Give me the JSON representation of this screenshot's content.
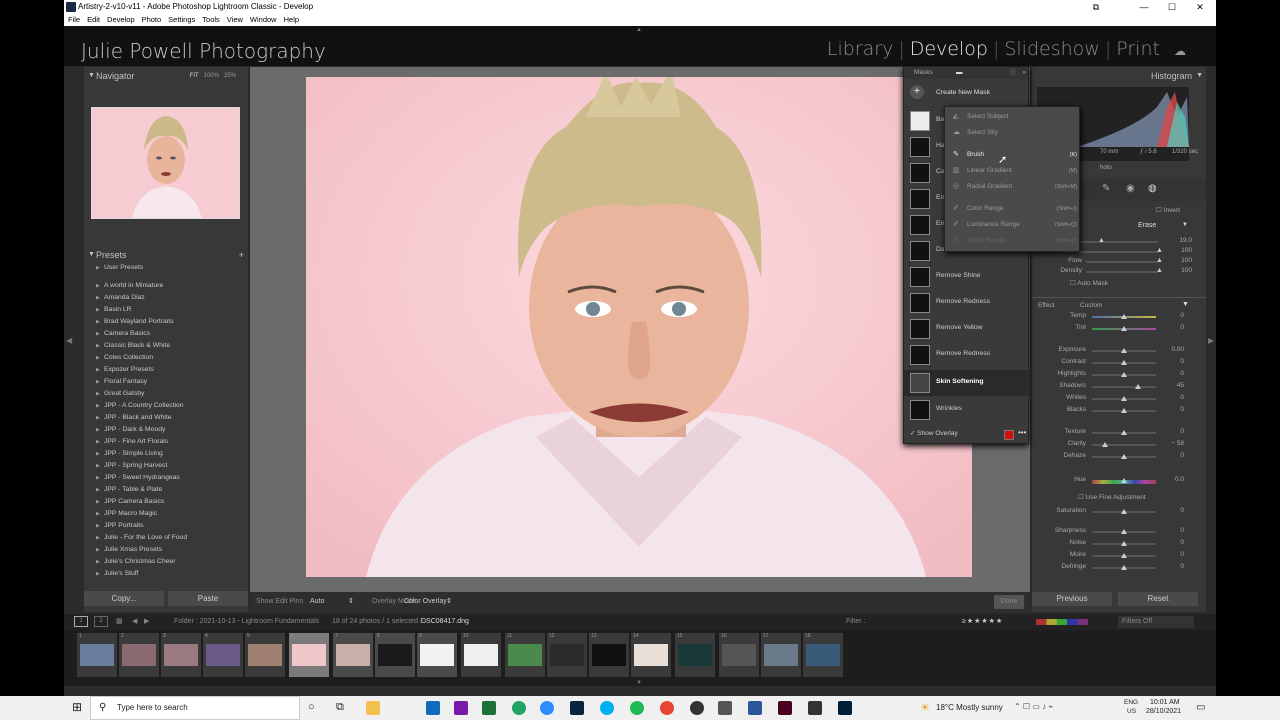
{
  "window": {
    "title": "Artistry-2-v10-v11 - Adobe Photoshop Lightroom Classic - Develop"
  },
  "menu": [
    "File",
    "Edit",
    "Develop",
    "Photo",
    "Settings",
    "Tools",
    "View",
    "Window",
    "Help"
  ],
  "identity": {
    "brand": "Julie Powell Photography"
  },
  "modules": [
    "Library",
    "Develop",
    "Slideshow",
    "Print"
  ],
  "navigator": {
    "title": "Navigator",
    "zoom_fit": "FIT",
    "zoom_100": "100%",
    "zoom_25": "25%"
  },
  "presets": {
    "title": "Presets",
    "items": [
      "User Presets",
      "A world in Miniature",
      "Amanda Diaz",
      "Basin LR",
      "Brad Wayland Portraits",
      "Camera Basics",
      "Classic Black & White",
      "Coles Collection",
      "Expozer Presets",
      "Floral Fantasy",
      "Great Gatsby",
      "JPP - A Country Collection",
      "JPP - Black and White",
      "JPP - Dark & Moody",
      "JPP - Fine Art Florals",
      "JPP - Simple Living",
      "JPP - Spring Harvest",
      "JPP - Sweet Hydrangeas",
      "JPP - Table & Plate",
      "JPP Camera Basics",
      "JPP Macro Magic",
      "JPP Portraits",
      "Julie - For the Love of Food",
      "Julie Xmas Presets",
      "Julie's Christmas Cheer",
      "Julie's Stuff"
    ]
  },
  "left_buttons": {
    "copy": "Copy...",
    "paste": "Paste"
  },
  "toolbar": {
    "show_edit_pins": "Show Edit Pins",
    "pins_value": "Auto",
    "overlay_mode": "Overlay Mode",
    "overlay_value": "Color Overlay",
    "done": "Done"
  },
  "masks": {
    "title": "Masks",
    "create": "Create New Mask",
    "items": [
      "Background",
      "Hair",
      "Catchlight",
      "Enhance Eyes",
      "Enhance Eyes",
      "Darken Eyes",
      "Remove Shine",
      "Remove Redness",
      "Remove Yellow",
      "Remove Redness",
      "Skin Softening",
      "Wrinkles"
    ],
    "selected": "Skin Softening",
    "show_overlay": "Show Overlay",
    "overlay_color": "#d01010"
  },
  "dropdown": {
    "items": [
      {
        "label": "Select Subject",
        "shortcut": ""
      },
      {
        "label": "Select Sky",
        "shortcut": ""
      },
      {
        "label": "Brush",
        "shortcut": "(K)"
      },
      {
        "label": "Linear Gradient",
        "shortcut": "(M)"
      },
      {
        "label": "Radial Gradient",
        "shortcut": "(Shift+M)"
      },
      {
        "label": "Color Range",
        "shortcut": "(Shift+J)"
      },
      {
        "label": "Luminance Range",
        "shortcut": "(Shift+Q)"
      },
      {
        "label": "Depth Range",
        "shortcut": "(Shift+Z)"
      }
    ]
  },
  "histogram": {
    "title": "Histogram",
    "focal": "70 mm",
    "aperture": "ƒ / 5.6",
    "shutter": "1/320 sec",
    "label_photo": "hoto"
  },
  "brush": {
    "invert": "Invert",
    "erase": "Erase",
    "size": "19.0",
    "feather": "100",
    "flow_label": "Flow",
    "flow": "100",
    "density_label": "Density",
    "density": "100",
    "auto_mask": "Auto Mask"
  },
  "effect": {
    "label": "Effect",
    "preset": "Custom",
    "sliders": [
      {
        "name": "Temp",
        "value": "0",
        "pos": 0.5
      },
      {
        "name": "Tint",
        "value": "0",
        "pos": 0.5
      },
      {
        "name": "Exposure",
        "value": "0.00",
        "pos": 0.5
      },
      {
        "name": "Contrast",
        "value": "0",
        "pos": 0.5
      },
      {
        "name": "Highlights",
        "value": "0",
        "pos": 0.5
      },
      {
        "name": "Shadows",
        "value": "45",
        "pos": 0.72
      },
      {
        "name": "Whites",
        "value": "0",
        "pos": 0.5
      },
      {
        "name": "Blacks",
        "value": "0",
        "pos": 0.5
      },
      {
        "name": "Texture",
        "value": "0",
        "pos": 0.5
      },
      {
        "name": "Clarity",
        "value": "− 58",
        "pos": 0.21
      },
      {
        "name": "Dehaze",
        "value": "0",
        "pos": 0.5
      },
      {
        "name": "Hue",
        "value": "0.0",
        "pos": 0.5
      },
      {
        "name": "Saturation",
        "value": "0",
        "pos": 0.5
      },
      {
        "name": "Sharpness",
        "value": "0",
        "pos": 0.5
      },
      {
        "name": "Noise",
        "value": "0",
        "pos": 0.5
      },
      {
        "name": "Moire",
        "value": "0",
        "pos": 0.5
      },
      {
        "name": "Defringe",
        "value": "0",
        "pos": 0.5
      }
    ],
    "fine_adjust": "Use Fine Adjustment"
  },
  "right_buttons": {
    "previous": "Previous",
    "reset": "Reset"
  },
  "filmstrip_bar": {
    "folder": "Folder : 2021-10-13 - Lightroom Fundamentals",
    "count": "18 of 24 photos / 1 selected /",
    "file": "DSC08417.dng",
    "filter": "Filter :",
    "filters_off": "Filters Off",
    "page1": "1",
    "page2": "2"
  },
  "filmstrip": {
    "numbers": [
      "1",
      "2",
      "3",
      "4",
      "5",
      "6",
      "7",
      "8",
      "9",
      "10",
      "11",
      "12",
      "13",
      "14",
      "15",
      "16",
      "17",
      "18",
      "19"
    ]
  },
  "taskbar": {
    "search": "Type here to search",
    "weather": "18°C  Mostly sunny",
    "lang": "ENG",
    "region": "US",
    "time": "10:01 AM",
    "date": "28/10/2021"
  }
}
